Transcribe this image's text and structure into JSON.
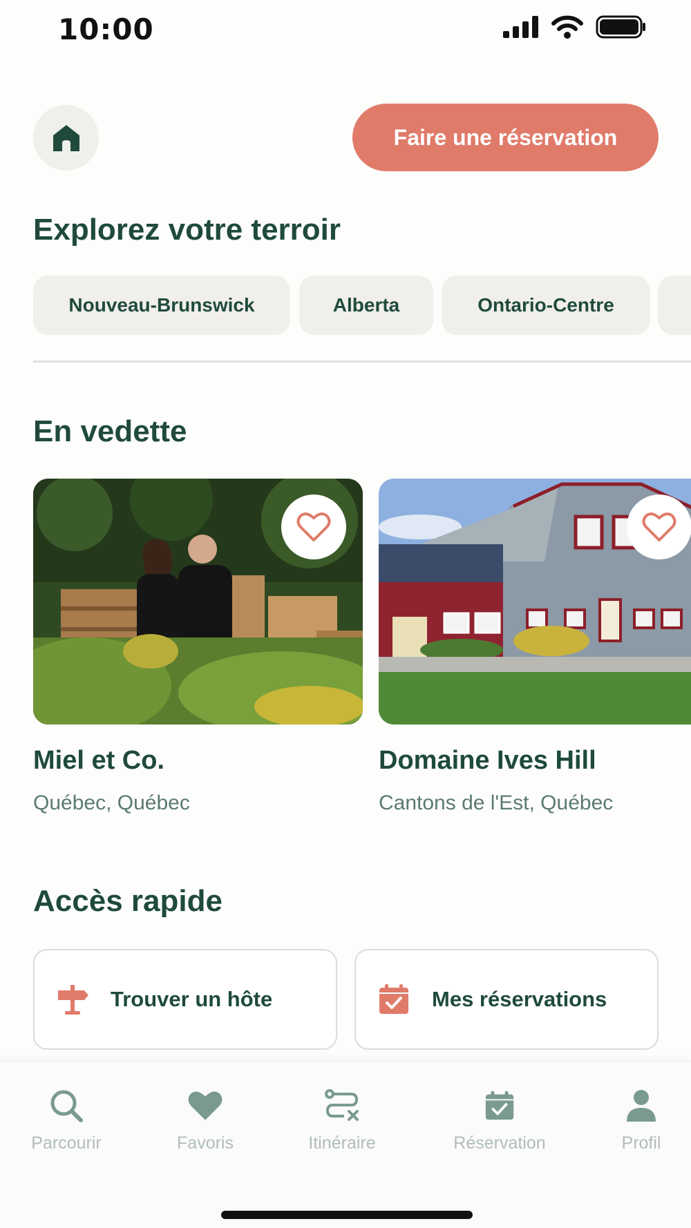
{
  "status_bar": {
    "time": "10:00"
  },
  "header": {
    "reserve_label": "Faire une réservation"
  },
  "terroir": {
    "title": "Explorez votre terroir",
    "chips": [
      "Nouveau-Brunswick",
      "Alberta",
      "Ontario-Centre"
    ]
  },
  "featured": {
    "title": "En vedette",
    "cards": [
      {
        "name": "Miel et Co.",
        "location": "Québec, Québec"
      },
      {
        "name": "Domaine Ives Hill",
        "location": "Cantons de l'Est, Québec"
      }
    ]
  },
  "quick_access": {
    "title": "Accès rapide",
    "items": [
      {
        "label": "Trouver un hôte",
        "icon": "signpost-icon"
      },
      {
        "label": "Mes réservations",
        "icon": "calendar-check-icon"
      }
    ]
  },
  "tabbar": {
    "items": [
      {
        "label": "Parcourir",
        "icon": "search-icon"
      },
      {
        "label": "Favoris",
        "icon": "heart-icon"
      },
      {
        "label": "Itinéraire",
        "icon": "route-icon"
      },
      {
        "label": "Réservation",
        "icon": "calendar-check-icon"
      },
      {
        "label": "Profil",
        "icon": "user-icon"
      }
    ]
  },
  "colors": {
    "primary_green": "#1f4a3c",
    "accent_coral": "#e07b6a",
    "chip_bg": "#f0efeb",
    "tab_icon": "#7a9a90",
    "tab_label": "#b1bdb8"
  }
}
